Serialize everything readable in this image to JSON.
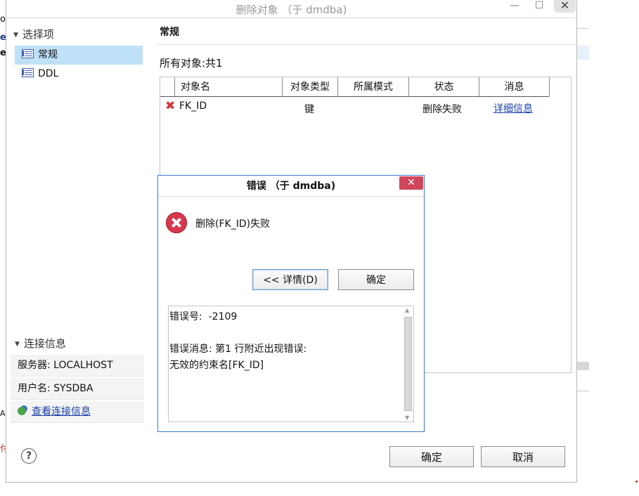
{
  "background": {
    "left_chars": [
      "oc",
      "e",
      "e",
      "A",
      "付"
    ]
  },
  "window": {
    "title": "删除对象  （于 dmdba)",
    "minimize_glyph": "—",
    "maximize_glyph": "☐",
    "close_glyph": "✕"
  },
  "sidebar": {
    "section_title": "选择项",
    "items": [
      {
        "label": "常规",
        "selected": true
      },
      {
        "label": "DDL",
        "selected": false
      }
    ]
  },
  "connection": {
    "section_title": "连接信息",
    "server": "服务器: LOCALHOST",
    "user": "用户名: SYSDBA",
    "view_link": "查看连接信息"
  },
  "main": {
    "tab_title": "常规",
    "object_count": "所有对象:共1",
    "table": {
      "headers": [
        "对象名",
        "对象类型",
        "所属模式",
        "状态",
        "消息"
      ],
      "rows": [
        {
          "name": "FK_ID",
          "type": "键",
          "schema": "",
          "status": "删除失败",
          "message": "详细信息"
        }
      ]
    }
  },
  "footer": {
    "ok_label": "确定",
    "cancel_label": "取消",
    "help_glyph": "?"
  },
  "error_dialog": {
    "title": "错误   （于 dmdba)",
    "close_glyph": "✕",
    "message": "删除(FK_ID)失败",
    "details_button": "<< 详情(D)",
    "ok_button": "确定",
    "details_text": "错误号:  -2109\n\n错误消息: 第1 行附近出现错误:\n无效的约束名[FK_ID]"
  },
  "colors": {
    "accent": "#3b7cc4",
    "selected_bg": "#bfe1f8",
    "error_red": "#d8384c",
    "link": "#1a3fa8"
  }
}
